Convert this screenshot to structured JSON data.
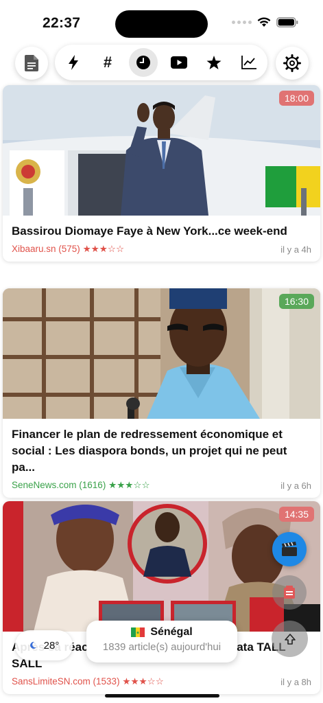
{
  "status_bar": {
    "time": "22:37"
  },
  "toolbar": {
    "left_icon": "document-icon",
    "tabs": [
      {
        "name": "lightning-icon",
        "active": false
      },
      {
        "name": "hashtag-icon",
        "label": "#",
        "active": false
      },
      {
        "name": "clock-icon",
        "active": true
      },
      {
        "name": "youtube-icon",
        "active": false
      },
      {
        "name": "star-icon",
        "active": false
      },
      {
        "name": "chart-icon",
        "active": false
      }
    ],
    "right_icon": "settings-icon"
  },
  "articles": [
    {
      "time": "18:00",
      "badge_color": "#e07373",
      "title": "Bassirou Diomaye Faye à New York...ce week-end",
      "source": "Xibaaru.sn (575)",
      "source_color": "#e0524a",
      "rating": 3,
      "stars": "★★★☆☆",
      "ago": "il y a 4h"
    },
    {
      "time": "16:30",
      "badge_color": "#5aa85a",
      "title": "Financer le plan de redressement économique et social : Les diaspora bonds, un projet qui ne peut pa...",
      "source": "SeneNews.com (1616)",
      "source_color": "#3aa24a",
      "rating": 3,
      "stars": "★★★☆☆",
      "ago": "il y a 6h"
    },
    {
      "time": "14:35",
      "badge_color": "#e07373",
      "title": "Après sa réac... taxes : Salma tance Aïssata TALL SALL",
      "source": "SansLimiteSN.com (1533)",
      "source_color": "#e0524a",
      "rating": 3,
      "stars": "★★★☆☆",
      "ago": "il y a 8h"
    }
  ],
  "weather": {
    "temp": "28°",
    "icon": "moon-icon"
  },
  "country": {
    "name": "Sénégal",
    "count": "1839 article(s) aujourd'hui"
  },
  "fabs": {
    "video_color": "#1e88e5",
    "news_color": "#e05757"
  }
}
